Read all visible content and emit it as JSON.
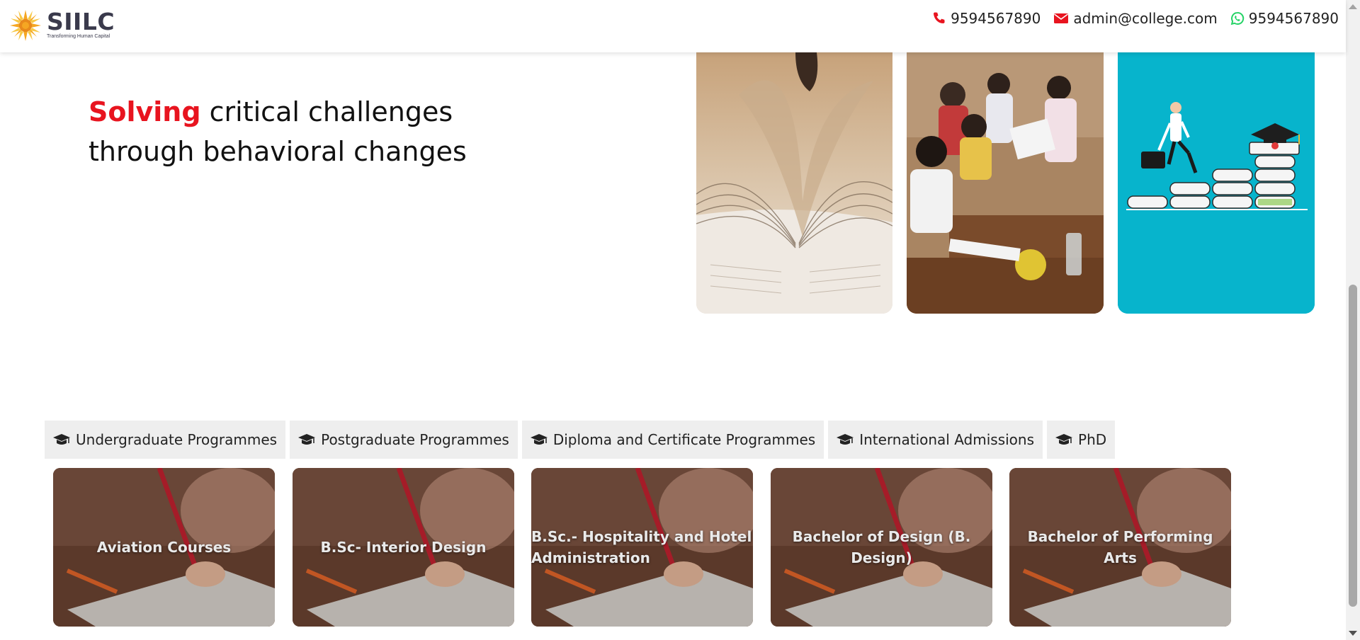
{
  "header": {
    "logo": {
      "name": "SIILC",
      "tagline": "Transforming Human Capital"
    },
    "contacts": [
      {
        "icon": "phone-icon",
        "text": "9594567890",
        "color": "#e8141f"
      },
      {
        "icon": "envelope-icon",
        "text": "admin@college.com",
        "color": "#e8141f"
      },
      {
        "icon": "whatsapp-icon",
        "text": "9594567890",
        "color": "#25d366"
      }
    ]
  },
  "hero": {
    "highlight": "Solving",
    "line1_rest": " critical challenges",
    "line2": "through behavioral changes",
    "accent_color": "#e8141f",
    "images": [
      "open-book-photo",
      "classroom-students-photo",
      "graduation-steps-illustration"
    ]
  },
  "tabs": [
    {
      "icon": "graduation-cap-icon",
      "label": "Undergraduate Programmes"
    },
    {
      "icon": "graduation-cap-icon",
      "label": "Postgraduate Programmes"
    },
    {
      "icon": "graduation-cap-icon",
      "label": "Diploma and Certificate Programmes"
    },
    {
      "icon": "graduation-cap-icon",
      "label": "International Admissions"
    },
    {
      "icon": "graduation-cap-icon",
      "label": "PhD"
    }
  ],
  "courses": [
    {
      "title": "Aviation Courses"
    },
    {
      "title": "B.Sc- Interior Design"
    },
    {
      "title": "B.Sc.- Hospitality and Hotel Administration"
    },
    {
      "title": "Bachelor of Design (B. Design)"
    },
    {
      "title": "Bachelor of Performing Arts"
    }
  ]
}
